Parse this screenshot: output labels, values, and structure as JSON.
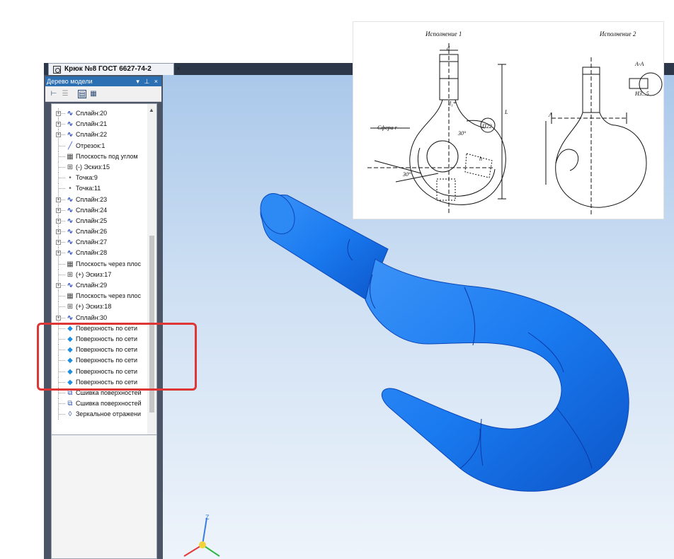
{
  "document": {
    "tab_title": "Крюк №8 ГОСТ 6627-74-2",
    "tab_close": "×"
  },
  "panel": {
    "title": "Дерево модели",
    "header_controls": "▾ ⊥ ×"
  },
  "tree": {
    "items": [
      {
        "label": "Сплайн:20",
        "icon": "spline-icon",
        "expandable": true
      },
      {
        "label": "Сплайн:21",
        "icon": "spline-icon",
        "expandable": true
      },
      {
        "label": "Сплайн:22",
        "icon": "spline-icon",
        "expandable": true
      },
      {
        "label": "Отрезок:1",
        "icon": "segment-icon",
        "expandable": false
      },
      {
        "label": "Плоскость под углом",
        "icon": "plane-icon",
        "expandable": false
      },
      {
        "label": "(-) Эскиз:15",
        "icon": "sketch-icon",
        "expandable": false
      },
      {
        "label": "Точка:9",
        "icon": "point-icon",
        "expandable": false
      },
      {
        "label": "Точка:11",
        "icon": "point-icon",
        "expandable": false
      },
      {
        "label": "Сплайн:23",
        "icon": "spline-icon",
        "expandable": true
      },
      {
        "label": "Сплайн:24",
        "icon": "spline-icon",
        "expandable": true
      },
      {
        "label": "Сплайн:25",
        "icon": "spline-icon",
        "expandable": true
      },
      {
        "label": "Сплайн:26",
        "icon": "spline-icon",
        "expandable": true
      },
      {
        "label": "Сплайн:27",
        "icon": "spline-icon",
        "expandable": true
      },
      {
        "label": "Сплайн:28",
        "icon": "spline-icon",
        "expandable": true
      },
      {
        "label": "Плоскость через плос",
        "icon": "plane-icon",
        "expandable": false
      },
      {
        "label": "(+) Эскиз:17",
        "icon": "sketch-icon",
        "expandable": false
      },
      {
        "label": "Сплайн:29",
        "icon": "spline-icon",
        "expandable": true
      },
      {
        "label": "Плоскость через плос",
        "icon": "plane-icon",
        "expandable": false
      },
      {
        "label": "(+) Эскиз:18",
        "icon": "sketch-icon",
        "expandable": false
      },
      {
        "label": "Сплайн:30",
        "icon": "spline-icon",
        "expandable": true
      },
      {
        "label": "Поверхность по сети",
        "icon": "mesh-surface-icon",
        "expandable": false
      },
      {
        "label": "Поверхность по сети",
        "icon": "mesh-surface-icon",
        "expandable": false
      },
      {
        "label": "Поверхность по сети",
        "icon": "mesh-surface-icon",
        "expandable": false
      },
      {
        "label": "Поверхность по сети",
        "icon": "mesh-surface-icon",
        "expandable": false
      },
      {
        "label": "Поверхность по сети",
        "icon": "mesh-surface-icon",
        "expandable": false
      },
      {
        "label": "Поверхность по сети",
        "icon": "mesh-surface-icon",
        "expandable": false
      },
      {
        "label": "Сшивка поверхностей",
        "icon": "stitch-surfaces-icon",
        "expandable": false
      },
      {
        "label": "Сшивка поверхностей",
        "icon": "stitch-surfaces-icon",
        "expandable": false
      },
      {
        "label": "Зеркальное отражени",
        "icon": "mirror-icon",
        "expandable": false
      }
    ]
  },
  "drawing": {
    "caption_left": "Исполнение 1",
    "caption_right": "Исполнение 2",
    "labels": {
      "d": "d",
      "d1": "d₁*",
      "sphere": "Сфера r",
      "p22": "П22",
      "section": "А-А",
      "a": "А",
      "angle1": "30°",
      "angle2": "30°",
      "m": "Ħ3...5",
      "l": "L",
      "h": "h"
    }
  },
  "colors": {
    "hook": "#1a7af0",
    "hook_dark": "#0c55c8",
    "highlight": "#de3535",
    "panel_header": "#2d6fb3"
  }
}
